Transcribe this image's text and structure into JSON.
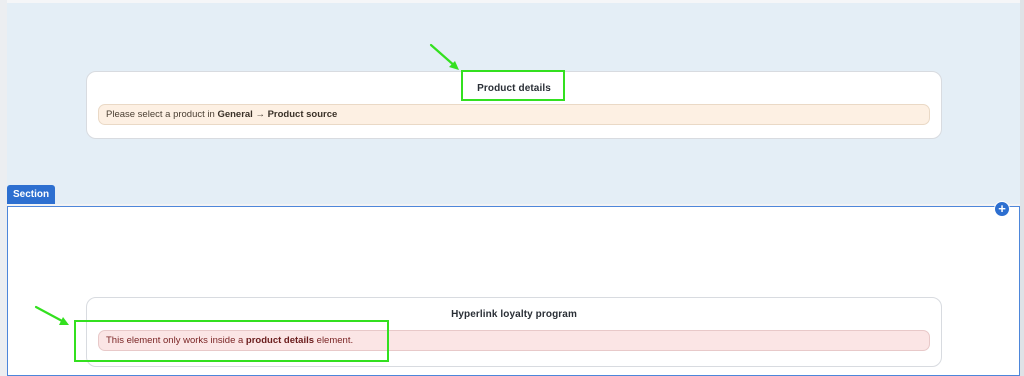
{
  "top_section": {
    "card": {
      "title": "Product details",
      "notice": {
        "prefix": "Please select a product in ",
        "bold": "General → Product source",
        "suffix": ""
      }
    }
  },
  "section_tag": {
    "label": "Section"
  },
  "add_button": {
    "icon": "+"
  },
  "bottom_section": {
    "card": {
      "title": "Hyperlink loyalty program",
      "notice": {
        "prefix": "This element only works inside a ",
        "bold": "product details",
        "suffix": " element."
      }
    }
  },
  "annotations": {
    "highlight_color": "#33e01f",
    "arrow_color": "#33e01f"
  },
  "colors": {
    "section_accent": "#2d6fd0",
    "top_section_bg": "#e4eef6"
  }
}
